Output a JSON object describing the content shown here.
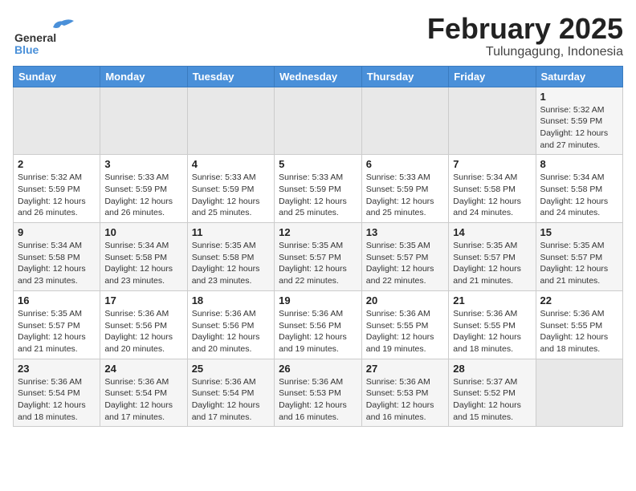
{
  "header": {
    "logo_general": "General",
    "logo_blue": "Blue",
    "title": "February 2025",
    "subtitle": "Tulungagung, Indonesia"
  },
  "calendar": {
    "days_of_week": [
      "Sunday",
      "Monday",
      "Tuesday",
      "Wednesday",
      "Thursday",
      "Friday",
      "Saturday"
    ],
    "weeks": [
      [
        {
          "day": "",
          "info": ""
        },
        {
          "day": "",
          "info": ""
        },
        {
          "day": "",
          "info": ""
        },
        {
          "day": "",
          "info": ""
        },
        {
          "day": "",
          "info": ""
        },
        {
          "day": "",
          "info": ""
        },
        {
          "day": "1",
          "info": "Sunrise: 5:32 AM\nSunset: 5:59 PM\nDaylight: 12 hours\nand 27 minutes."
        }
      ],
      [
        {
          "day": "2",
          "info": "Sunrise: 5:32 AM\nSunset: 5:59 PM\nDaylight: 12 hours\nand 26 minutes."
        },
        {
          "day": "3",
          "info": "Sunrise: 5:33 AM\nSunset: 5:59 PM\nDaylight: 12 hours\nand 26 minutes."
        },
        {
          "day": "4",
          "info": "Sunrise: 5:33 AM\nSunset: 5:59 PM\nDaylight: 12 hours\nand 25 minutes."
        },
        {
          "day": "5",
          "info": "Sunrise: 5:33 AM\nSunset: 5:59 PM\nDaylight: 12 hours\nand 25 minutes."
        },
        {
          "day": "6",
          "info": "Sunrise: 5:33 AM\nSunset: 5:59 PM\nDaylight: 12 hours\nand 25 minutes."
        },
        {
          "day": "7",
          "info": "Sunrise: 5:34 AM\nSunset: 5:58 PM\nDaylight: 12 hours\nand 24 minutes."
        },
        {
          "day": "8",
          "info": "Sunrise: 5:34 AM\nSunset: 5:58 PM\nDaylight: 12 hours\nand 24 minutes."
        }
      ],
      [
        {
          "day": "9",
          "info": "Sunrise: 5:34 AM\nSunset: 5:58 PM\nDaylight: 12 hours\nand 23 minutes."
        },
        {
          "day": "10",
          "info": "Sunrise: 5:34 AM\nSunset: 5:58 PM\nDaylight: 12 hours\nand 23 minutes."
        },
        {
          "day": "11",
          "info": "Sunrise: 5:35 AM\nSunset: 5:58 PM\nDaylight: 12 hours\nand 23 minutes."
        },
        {
          "day": "12",
          "info": "Sunrise: 5:35 AM\nSunset: 5:57 PM\nDaylight: 12 hours\nand 22 minutes."
        },
        {
          "day": "13",
          "info": "Sunrise: 5:35 AM\nSunset: 5:57 PM\nDaylight: 12 hours\nand 22 minutes."
        },
        {
          "day": "14",
          "info": "Sunrise: 5:35 AM\nSunset: 5:57 PM\nDaylight: 12 hours\nand 21 minutes."
        },
        {
          "day": "15",
          "info": "Sunrise: 5:35 AM\nSunset: 5:57 PM\nDaylight: 12 hours\nand 21 minutes."
        }
      ],
      [
        {
          "day": "16",
          "info": "Sunrise: 5:35 AM\nSunset: 5:57 PM\nDaylight: 12 hours\nand 21 minutes."
        },
        {
          "day": "17",
          "info": "Sunrise: 5:36 AM\nSunset: 5:56 PM\nDaylight: 12 hours\nand 20 minutes."
        },
        {
          "day": "18",
          "info": "Sunrise: 5:36 AM\nSunset: 5:56 PM\nDaylight: 12 hours\nand 20 minutes."
        },
        {
          "day": "19",
          "info": "Sunrise: 5:36 AM\nSunset: 5:56 PM\nDaylight: 12 hours\nand 19 minutes."
        },
        {
          "day": "20",
          "info": "Sunrise: 5:36 AM\nSunset: 5:55 PM\nDaylight: 12 hours\nand 19 minutes."
        },
        {
          "day": "21",
          "info": "Sunrise: 5:36 AM\nSunset: 5:55 PM\nDaylight: 12 hours\nand 18 minutes."
        },
        {
          "day": "22",
          "info": "Sunrise: 5:36 AM\nSunset: 5:55 PM\nDaylight: 12 hours\nand 18 minutes."
        }
      ],
      [
        {
          "day": "23",
          "info": "Sunrise: 5:36 AM\nSunset: 5:54 PM\nDaylight: 12 hours\nand 18 minutes."
        },
        {
          "day": "24",
          "info": "Sunrise: 5:36 AM\nSunset: 5:54 PM\nDaylight: 12 hours\nand 17 minutes."
        },
        {
          "day": "25",
          "info": "Sunrise: 5:36 AM\nSunset: 5:54 PM\nDaylight: 12 hours\nand 17 minutes."
        },
        {
          "day": "26",
          "info": "Sunrise: 5:36 AM\nSunset: 5:53 PM\nDaylight: 12 hours\nand 16 minutes."
        },
        {
          "day": "27",
          "info": "Sunrise: 5:36 AM\nSunset: 5:53 PM\nDaylight: 12 hours\nand 16 minutes."
        },
        {
          "day": "28",
          "info": "Sunrise: 5:37 AM\nSunset: 5:52 PM\nDaylight: 12 hours\nand 15 minutes."
        },
        {
          "day": "",
          "info": ""
        }
      ]
    ]
  }
}
